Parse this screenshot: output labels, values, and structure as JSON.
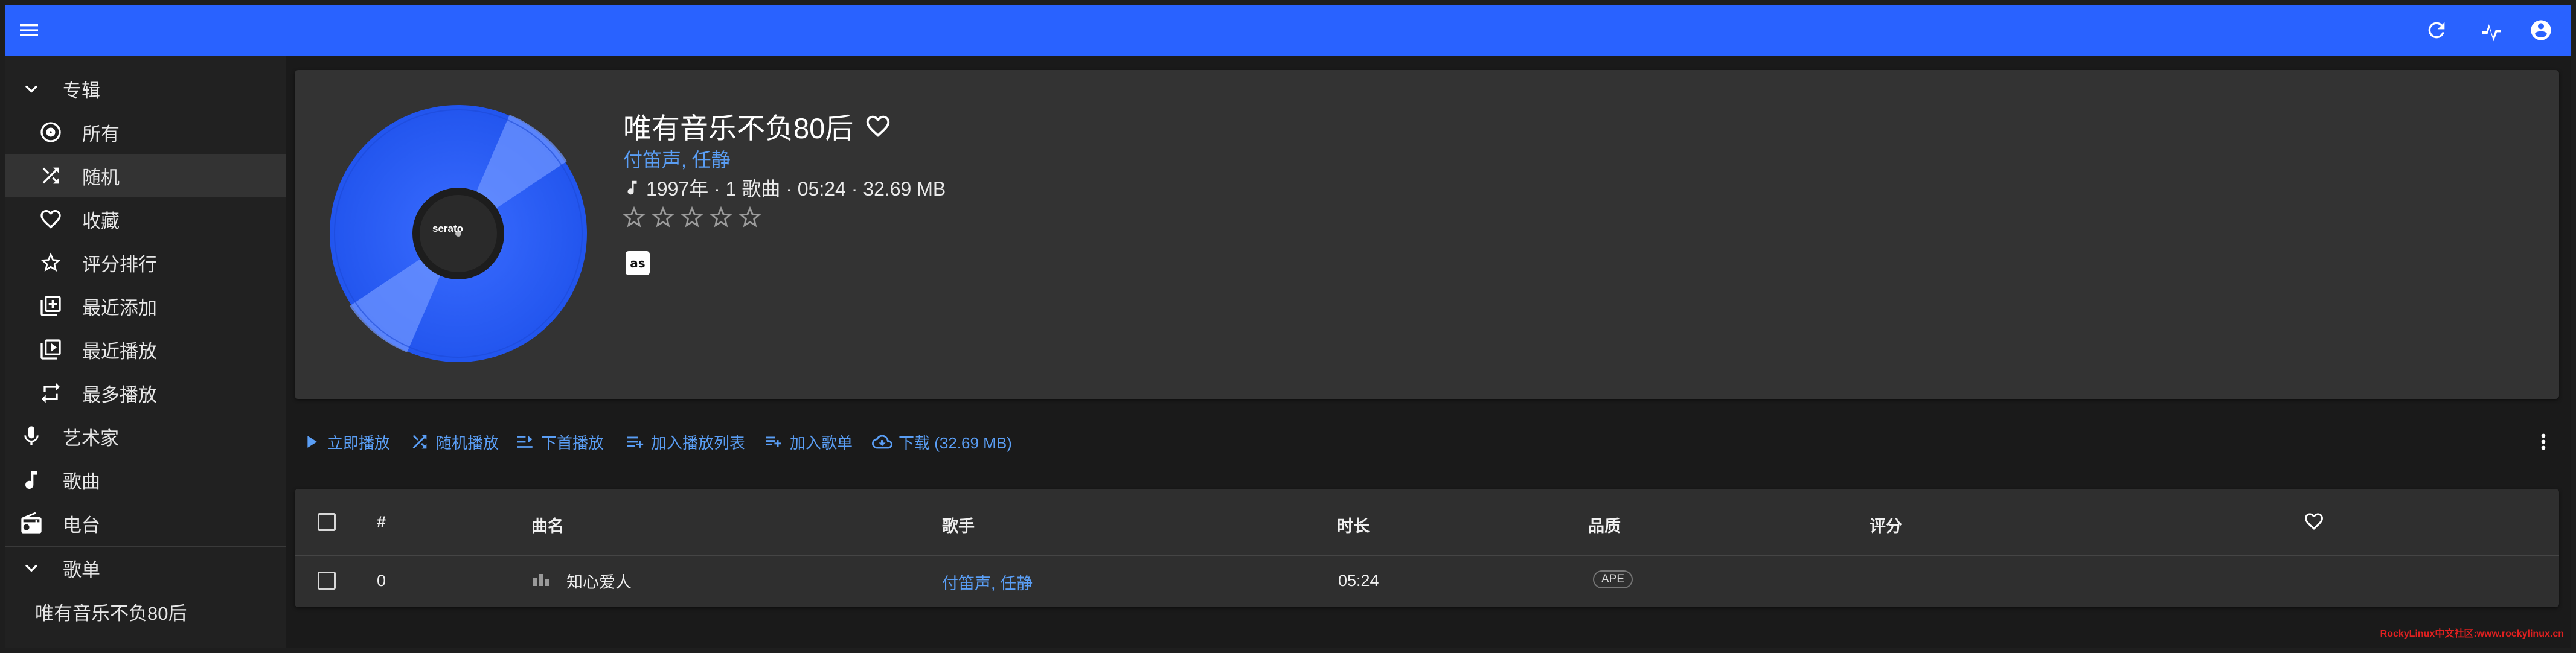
{
  "sidebar": {
    "albums_label": "专辑",
    "items": [
      {
        "label": "所有",
        "icon": "album-icon"
      },
      {
        "label": "随机",
        "icon": "shuffle-icon"
      },
      {
        "label": "收藏",
        "icon": "heart-icon"
      },
      {
        "label": "评分排行",
        "icon": "star-icon"
      },
      {
        "label": "最近添加",
        "icon": "library-add-icon"
      },
      {
        "label": "最近播放",
        "icon": "video-library-icon"
      },
      {
        "label": "最多播放",
        "icon": "repeat-icon"
      }
    ],
    "artists_label": "艺术家",
    "songs_label": "歌曲",
    "radio_label": "电台",
    "playlists_label": "歌单",
    "playlist_items": [
      "唯有音乐不负80后"
    ]
  },
  "album": {
    "title": "唯有音乐不负80后",
    "artist": "付笛声, 任静",
    "info": "1997年 · 1 歌曲 · 05:24 · 32.69 MB",
    "rating": 0,
    "max_rating": 5,
    "cover_label": "serato",
    "cover_color": "#2a5df0"
  },
  "toolbar": {
    "play": "立即播放",
    "shuffle": "随机播放",
    "play_next": "下首播放",
    "add_to_queue": "加入播放列表",
    "add_to_playlist": "加入歌单",
    "download": "下载 (32.69 MB)"
  },
  "table": {
    "headers": {
      "num": "#",
      "title": "曲名",
      "artist": "歌手",
      "duration": "时长",
      "quality": "品质",
      "rating": "评分"
    },
    "rows": [
      {
        "num": "0",
        "title": "知心爱人",
        "artist": "付笛声, 任静",
        "duration": "05:24",
        "quality": "APE"
      }
    ]
  },
  "watermark": "RockyLinux中文社区:www.rockylinux.cn",
  "colors": {
    "appbar": "#2962ff",
    "link": "#5a9ef5",
    "background": "#1a1a1a",
    "card": "#333333"
  }
}
